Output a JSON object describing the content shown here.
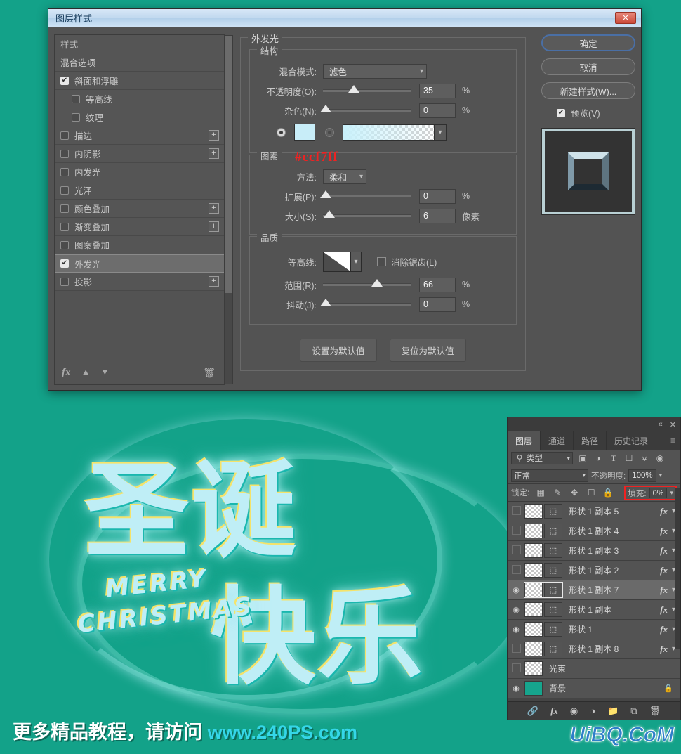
{
  "dialog": {
    "title": "图层样式",
    "close_label": "✕",
    "styles_header": "样式",
    "styles_list": [
      {
        "label": "样式",
        "checkbox": "none",
        "indent": false,
        "plus": false,
        "selected": false
      },
      {
        "label": "混合选项",
        "checkbox": "none",
        "indent": false,
        "plus": false,
        "selected": false
      },
      {
        "label": "斜面和浮雕",
        "checkbox": "checked",
        "indent": false,
        "plus": false,
        "selected": false
      },
      {
        "label": "等高线",
        "checkbox": "unchecked",
        "indent": true,
        "plus": false,
        "selected": false
      },
      {
        "label": "纹理",
        "checkbox": "unchecked",
        "indent": true,
        "plus": false,
        "selected": false
      },
      {
        "label": "描边",
        "checkbox": "unchecked",
        "indent": false,
        "plus": true,
        "selected": false
      },
      {
        "label": "内阴影",
        "checkbox": "unchecked",
        "indent": false,
        "plus": true,
        "selected": false
      },
      {
        "label": "内发光",
        "checkbox": "unchecked",
        "indent": false,
        "plus": false,
        "selected": false
      },
      {
        "label": "光泽",
        "checkbox": "unchecked",
        "indent": false,
        "plus": false,
        "selected": false
      },
      {
        "label": "颜色叠加",
        "checkbox": "unchecked",
        "indent": false,
        "plus": true,
        "selected": false
      },
      {
        "label": "渐变叠加",
        "checkbox": "unchecked",
        "indent": false,
        "plus": true,
        "selected": false
      },
      {
        "label": "图案叠加",
        "checkbox": "unchecked",
        "indent": false,
        "plus": false,
        "selected": false
      },
      {
        "label": "外发光",
        "checkbox": "checked",
        "indent": false,
        "plus": false,
        "selected": true
      },
      {
        "label": "投影",
        "checkbox": "unchecked",
        "indent": false,
        "plus": true,
        "selected": false
      }
    ],
    "footer_icons": [
      "fx-icon",
      "up-arrow-icon",
      "down-arrow-icon",
      "trash-icon"
    ],
    "section": {
      "title": "外发光",
      "structure": {
        "legend": "结构",
        "blend_mode_label": "混合模式:",
        "blend_mode_value": "滤色",
        "opacity_label": "不透明度(O):",
        "opacity_value": "35",
        "opacity_unit": "%",
        "noise_label": "杂色(N):",
        "noise_value": "0",
        "noise_unit": "%",
        "color_swatch_hex": "#c8edf8",
        "color_mode": "solid"
      },
      "elements": {
        "legend": "图素",
        "annotation": "#ccf7ff",
        "method_label": "方法:",
        "method_value": "柔和",
        "spread_label": "扩展(P):",
        "spread_value": "0",
        "spread_unit": "%",
        "size_label": "大小(S):",
        "size_value": "6",
        "size_unit": "像素"
      },
      "quality": {
        "legend": "品质",
        "contour_label": "等高线:",
        "antialias_label": "消除锯齿(L)",
        "range_label": "范围(R):",
        "range_value": "66",
        "range_unit": "%",
        "jitter_label": "抖动(J):",
        "jitter_value": "0",
        "jitter_unit": "%"
      },
      "default_buttons": {
        "set_default": "设置为默认值",
        "reset_default": "复位为默认值"
      }
    },
    "actions": {
      "ok": "确定",
      "cancel": "取消",
      "new_style": "新建样式(W)...",
      "preview_label": "预览(V)"
    }
  },
  "layers_panel": {
    "collapse_label": "«",
    "close_label": "✕",
    "tabs": [
      {
        "label": "图层",
        "active": true
      },
      {
        "label": "通道",
        "active": false
      },
      {
        "label": "路径",
        "active": false
      },
      {
        "label": "历史记录",
        "active": false
      }
    ],
    "menu_icon": "≡",
    "filter": {
      "search_icon": "⌕",
      "kind_value": "类型",
      "icons": [
        "image-filter-icon",
        "adjustment-filter-icon",
        "text-filter-icon",
        "shape-filter-icon",
        "smartobject-filter-icon",
        "toggle-filter-icon"
      ]
    },
    "blend": {
      "mode_value": "正常",
      "opacity_label": "不透明度:",
      "opacity_value": "100%"
    },
    "lock": {
      "label": "锁定:",
      "icons": [
        "lock-transparent-icon",
        "lock-image-icon",
        "lock-position-icon",
        "lock-artboard-icon",
        "lock-all-icon"
      ],
      "fill_label": "填充:",
      "fill_value": "0%",
      "highlight_color": "#ef2222"
    },
    "layers": [
      {
        "name": "形状 1 副本 5",
        "visible": false,
        "fx": true,
        "selected": false,
        "thumb": "transparent",
        "locked": false
      },
      {
        "name": "形状 1 副本 4",
        "visible": false,
        "fx": true,
        "selected": false,
        "thumb": "transparent",
        "locked": false
      },
      {
        "name": "形状 1 副本 3",
        "visible": false,
        "fx": true,
        "selected": false,
        "thumb": "transparent",
        "locked": false
      },
      {
        "name": "形状 1 副本 2",
        "visible": false,
        "fx": true,
        "selected": false,
        "thumb": "transparent",
        "locked": false
      },
      {
        "name": "形状 1 副本 7",
        "visible": true,
        "fx": true,
        "selected": true,
        "thumb": "transparent",
        "locked": false
      },
      {
        "name": "形状 1 副本",
        "visible": true,
        "fx": true,
        "selected": false,
        "thumb": "transparent",
        "locked": false
      },
      {
        "name": "形状 1",
        "visible": true,
        "fx": true,
        "selected": false,
        "thumb": "transparent",
        "locked": false
      },
      {
        "name": "形状 1 副本 8",
        "visible": false,
        "fx": true,
        "selected": false,
        "thumb": "transparent",
        "locked": false
      },
      {
        "name": "光束",
        "visible": false,
        "fx": false,
        "selected": false,
        "thumb": "transparent",
        "locked": false
      },
      {
        "name": "背景",
        "visible": true,
        "fx": false,
        "selected": false,
        "thumb": "teal",
        "locked": true
      }
    ],
    "bottom_icons": [
      "link-icon",
      "fx-icon",
      "mask-icon",
      "adjustment-icon",
      "group-icon",
      "new-layer-icon",
      "delete-icon"
    ]
  },
  "artwork": {
    "line1": "圣诞",
    "line2": "快乐",
    "merry": "MERRY",
    "christmas": "CHRISTMAS"
  },
  "watermarks": {
    "left_text": "更多精品教程，请访问 ",
    "left_url": "www.240PS.com",
    "right_text": "UiBQ.CoM"
  },
  "colors": {
    "canvas_bg": "#13a289",
    "dialog_bg": "#535353",
    "glow_color": "#c8edf8",
    "accent_red": "#ef2222",
    "watermark_cyan": "#35d6e8"
  }
}
